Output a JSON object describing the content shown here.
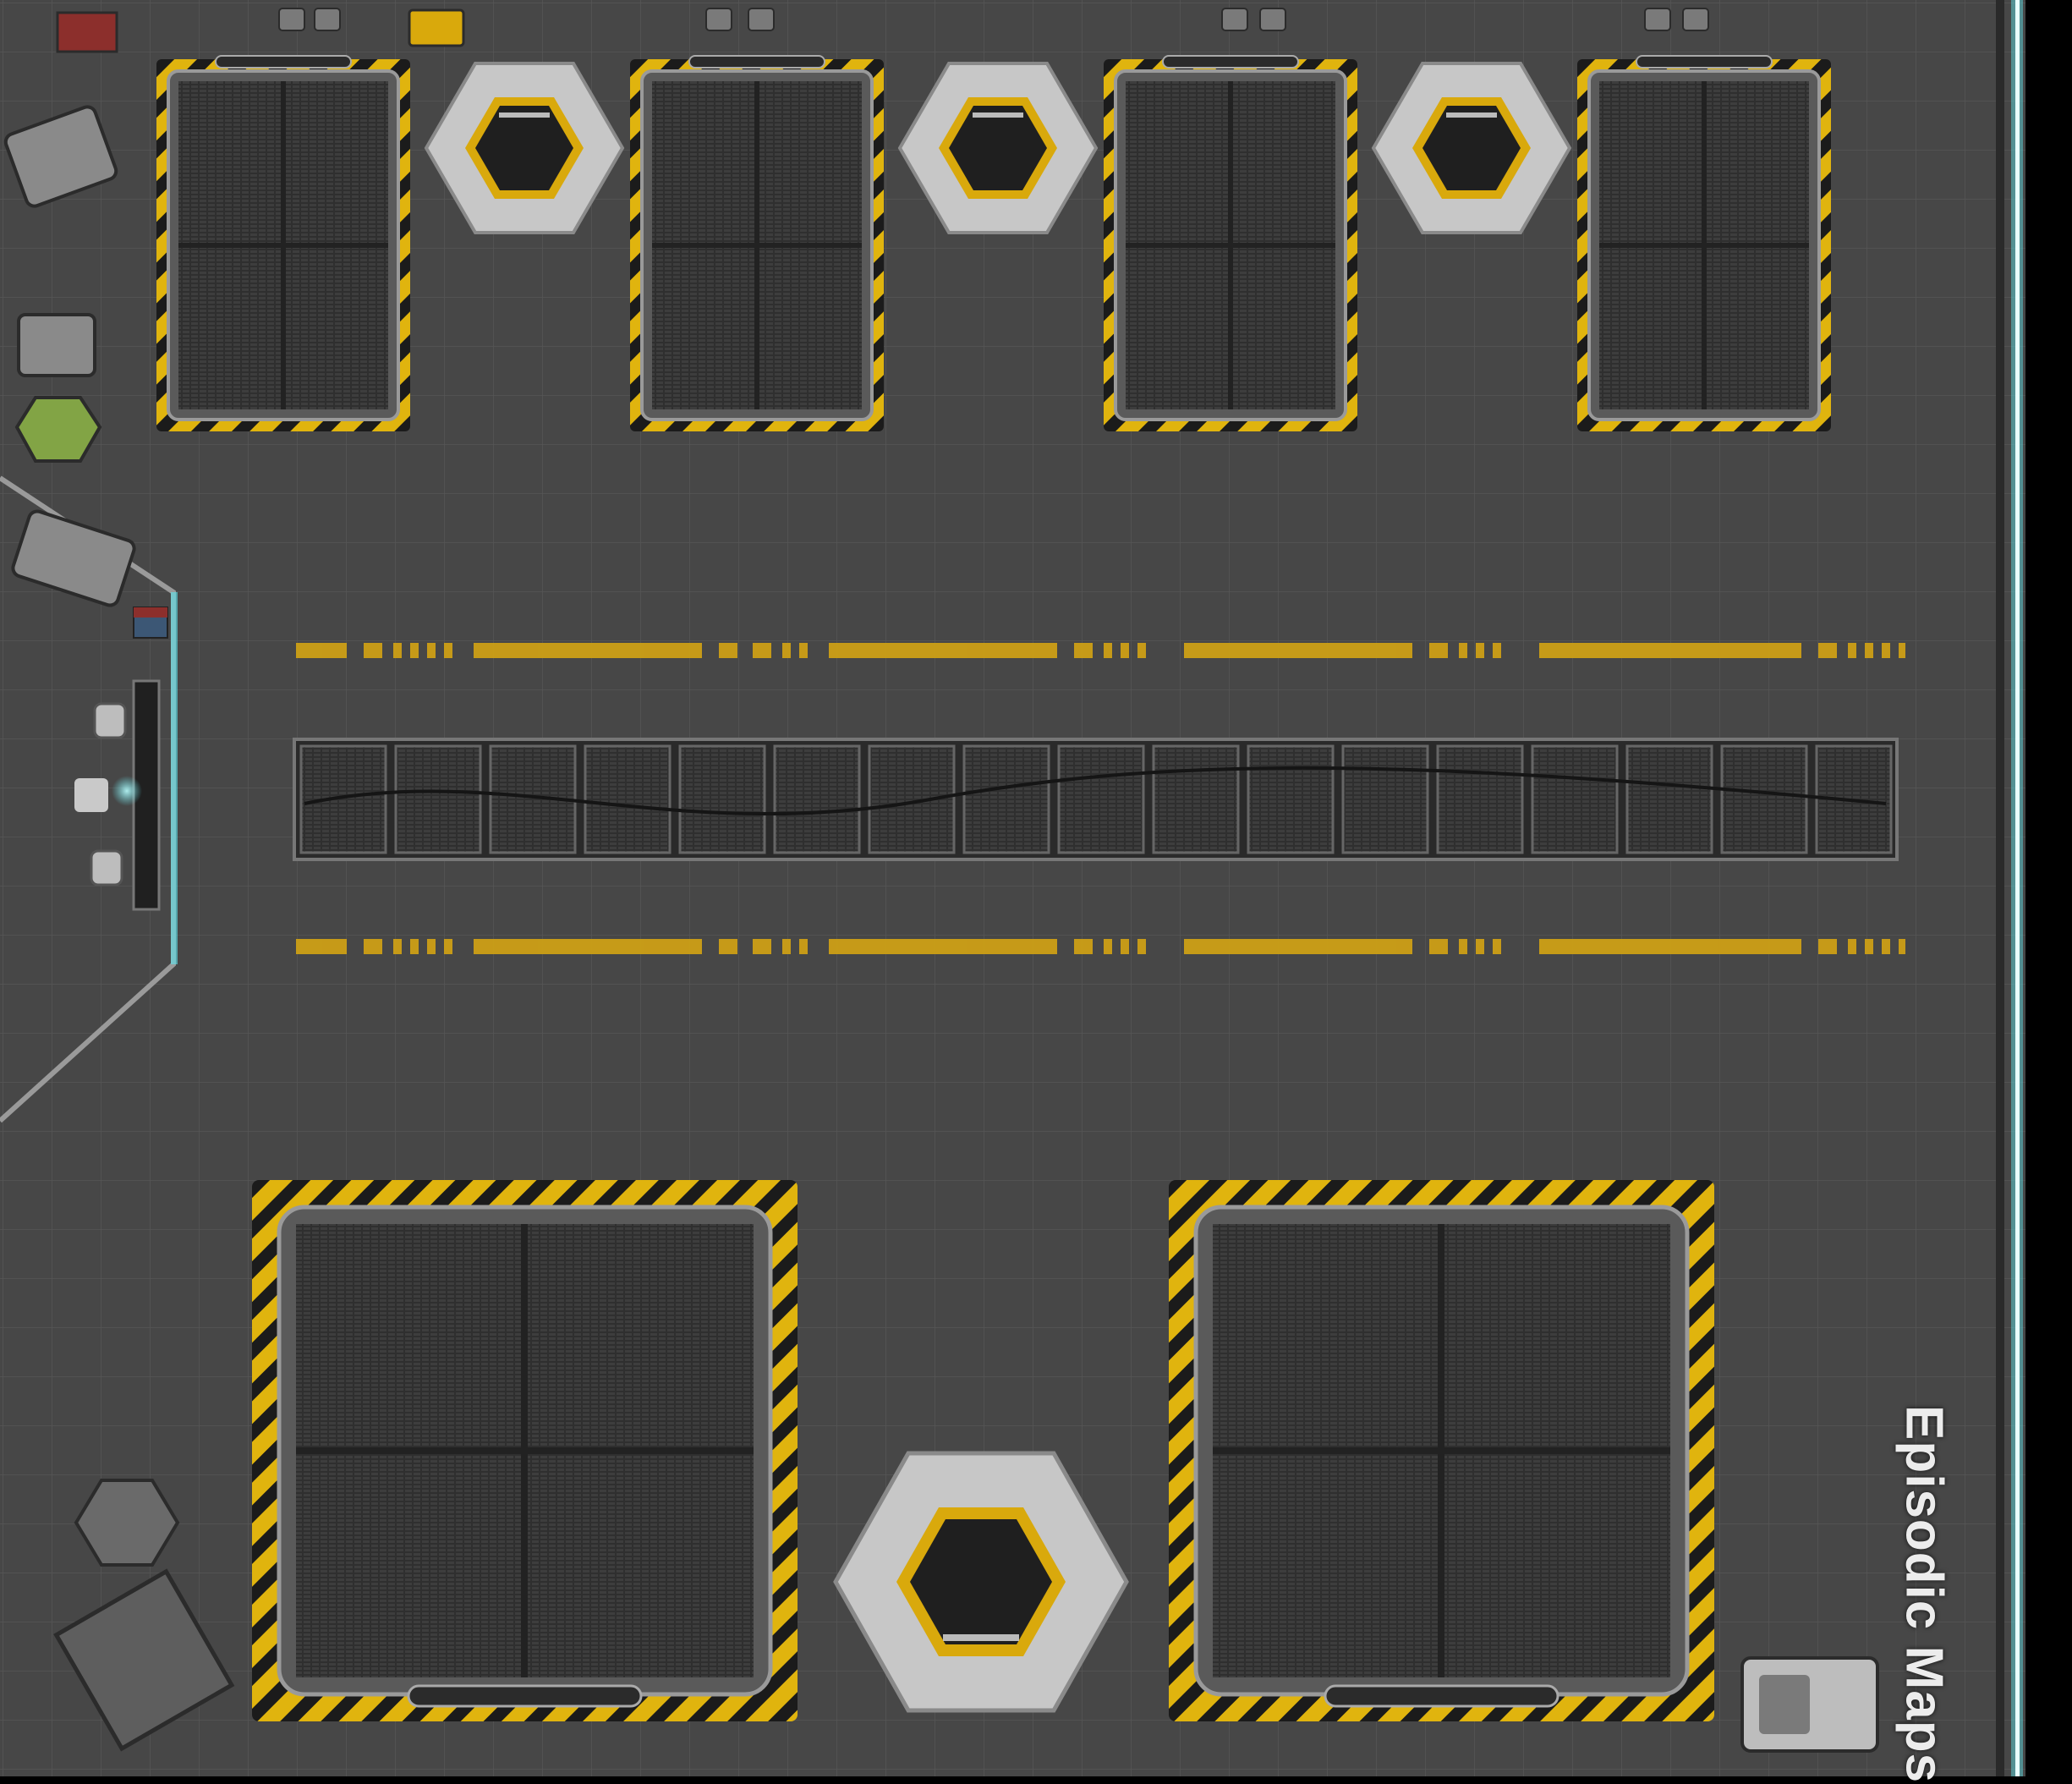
{
  "map": {
    "watermark": "Episodic Maps",
    "colors": {
      "floor": "#474747",
      "grid_line": "#565656",
      "hazard_yellow": "#e0b40e",
      "hazard_black": "#1b1b1b",
      "grate_dark": "#2f2f2f",
      "panel_light": "#c7c7c7",
      "energy_edge": "#5fe6ee",
      "space": "#000000",
      "crate_green": "#82a445",
      "crate_red": "#8c2f2c"
    },
    "icons": {
      "small_landing_pad": "hazard-striped-landing-pad-icon",
      "large_landing_pad": "large-hazard-striped-landing-pad-icon",
      "hex_lift": "hexagonal-cargo-lift-icon",
      "floor_grate": "floor-grate-trench-icon",
      "lane_marking": "yellow-dashed-lane-marking-icon",
      "control_console": "control-console-icon",
      "energy_barrier": "energy-field-barrier-icon",
      "cargo_crate": "cargo-crate-icon",
      "generator": "generator-machine-icon"
    }
  }
}
